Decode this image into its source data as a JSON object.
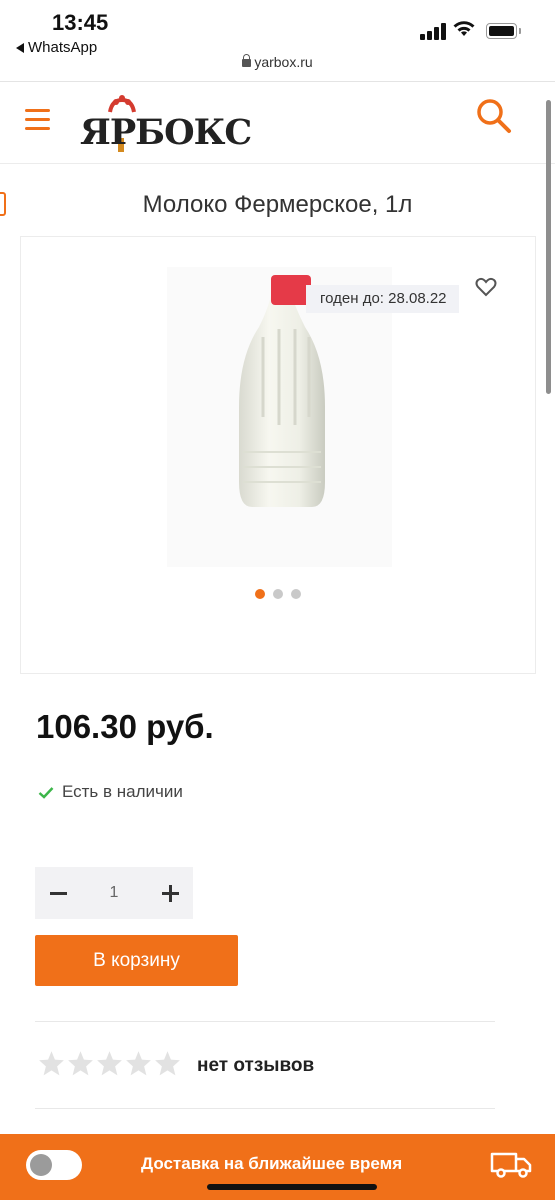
{
  "status_bar": {
    "time": "13:45",
    "back_app": "WhatsApp",
    "url": "yarbox.ru"
  },
  "header": {
    "logo_text": "ЯРБОКС",
    "menu_icon": "hamburger-icon",
    "search_icon": "search-icon"
  },
  "product": {
    "title": "Молоко Фермерское, 1л",
    "expiry_badge": "годен до: 28.08.22",
    "gallery_dots": 3,
    "active_dot": 1,
    "price": "106.30 руб.",
    "stock": "Есть в наличии",
    "quantity": "1",
    "add_to_cart": "В корзину",
    "rating": 0,
    "rating_max": 5,
    "reviews": "нет отзывов"
  },
  "delivery_bar": {
    "text": "Доставка на ближайшее время",
    "toggle_on": false
  },
  "colors": {
    "accent": "#f07019",
    "stock_check": "#3cb64a",
    "star_empty": "#e2e2e2"
  }
}
